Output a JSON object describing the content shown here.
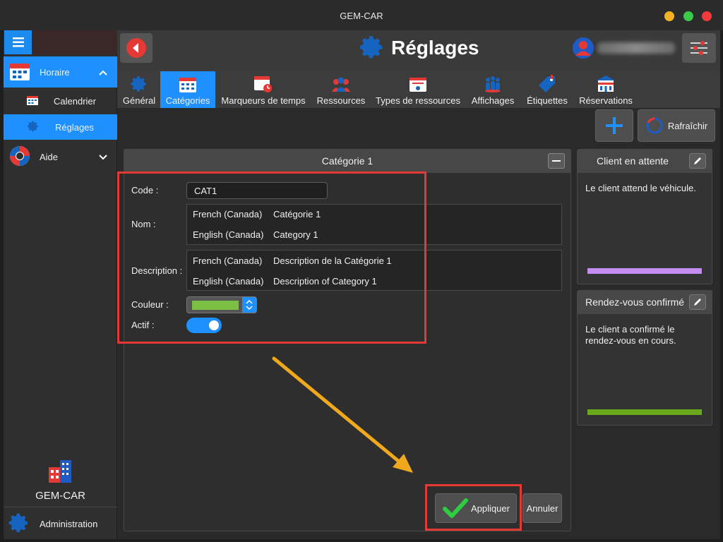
{
  "window": {
    "title": "GEM-CAR"
  },
  "sidebar": {
    "menu_icon": "hamburger-icon",
    "items": [
      {
        "label": "Horaire",
        "icon": "calendar-icon",
        "expanded": true
      },
      {
        "label": "Calendrier",
        "icon": "calendar-small-icon"
      },
      {
        "label": "Réglages",
        "icon": "gear-icon",
        "active": true
      },
      {
        "label": "Aide",
        "icon": "lifebuoy-icon",
        "expanded": false
      }
    ],
    "brand": "GEM-CAR",
    "admin": "Administration"
  },
  "header": {
    "title": "Réglages"
  },
  "tabs": [
    {
      "label": "Général",
      "icon": "gear-icon"
    },
    {
      "label": "Catégories",
      "icon": "calendar-grid-icon",
      "active": true
    },
    {
      "label": "Marqueurs de temps",
      "icon": "calendar-clock-icon"
    },
    {
      "label": "Ressources",
      "icon": "people-icon"
    },
    {
      "label": "Types de ressources",
      "icon": "id-card-icon"
    },
    {
      "label": "Affichages",
      "icon": "group-icon"
    },
    {
      "label": "Étiquettes",
      "icon": "tag-icon"
    },
    {
      "label": "Réservations",
      "icon": "building-icon"
    }
  ],
  "toolbar": {
    "add_icon": "plus-icon",
    "refresh_label": "Rafraîchir"
  },
  "form": {
    "panel_title": "Catégorie 1",
    "code_label": "Code :",
    "code_value": "CAT1",
    "name_label": "Nom :",
    "names": [
      {
        "lang": "French (Canada)",
        "value": "Catégorie 1"
      },
      {
        "lang": "English (Canada)",
        "value": "Category 1"
      }
    ],
    "description_label": "Description :",
    "descriptions": [
      {
        "lang": "French (Canada)",
        "value": "Description de la Catégorie 1"
      },
      {
        "lang": "English (Canada)",
        "value": "Description of Category 1"
      }
    ],
    "color_label": "Couleur :",
    "color_value": "#7cc043",
    "active_label": "Actif :",
    "active_value": true,
    "apply_label": "Appliquer",
    "cancel_label": "Annuler"
  },
  "cards": [
    {
      "title": "Client en attente",
      "text": "Le client attend le véhicule.",
      "color": "#c38cf0"
    },
    {
      "title": "Rendez-vous confirmé",
      "text": "Le client a confirmé le rendez-vous en cours.",
      "color": "#6aa81c"
    }
  ],
  "colors": {
    "accent": "#1e90ff",
    "highlight": "#e53935",
    "arrow": "#f0a81c"
  }
}
